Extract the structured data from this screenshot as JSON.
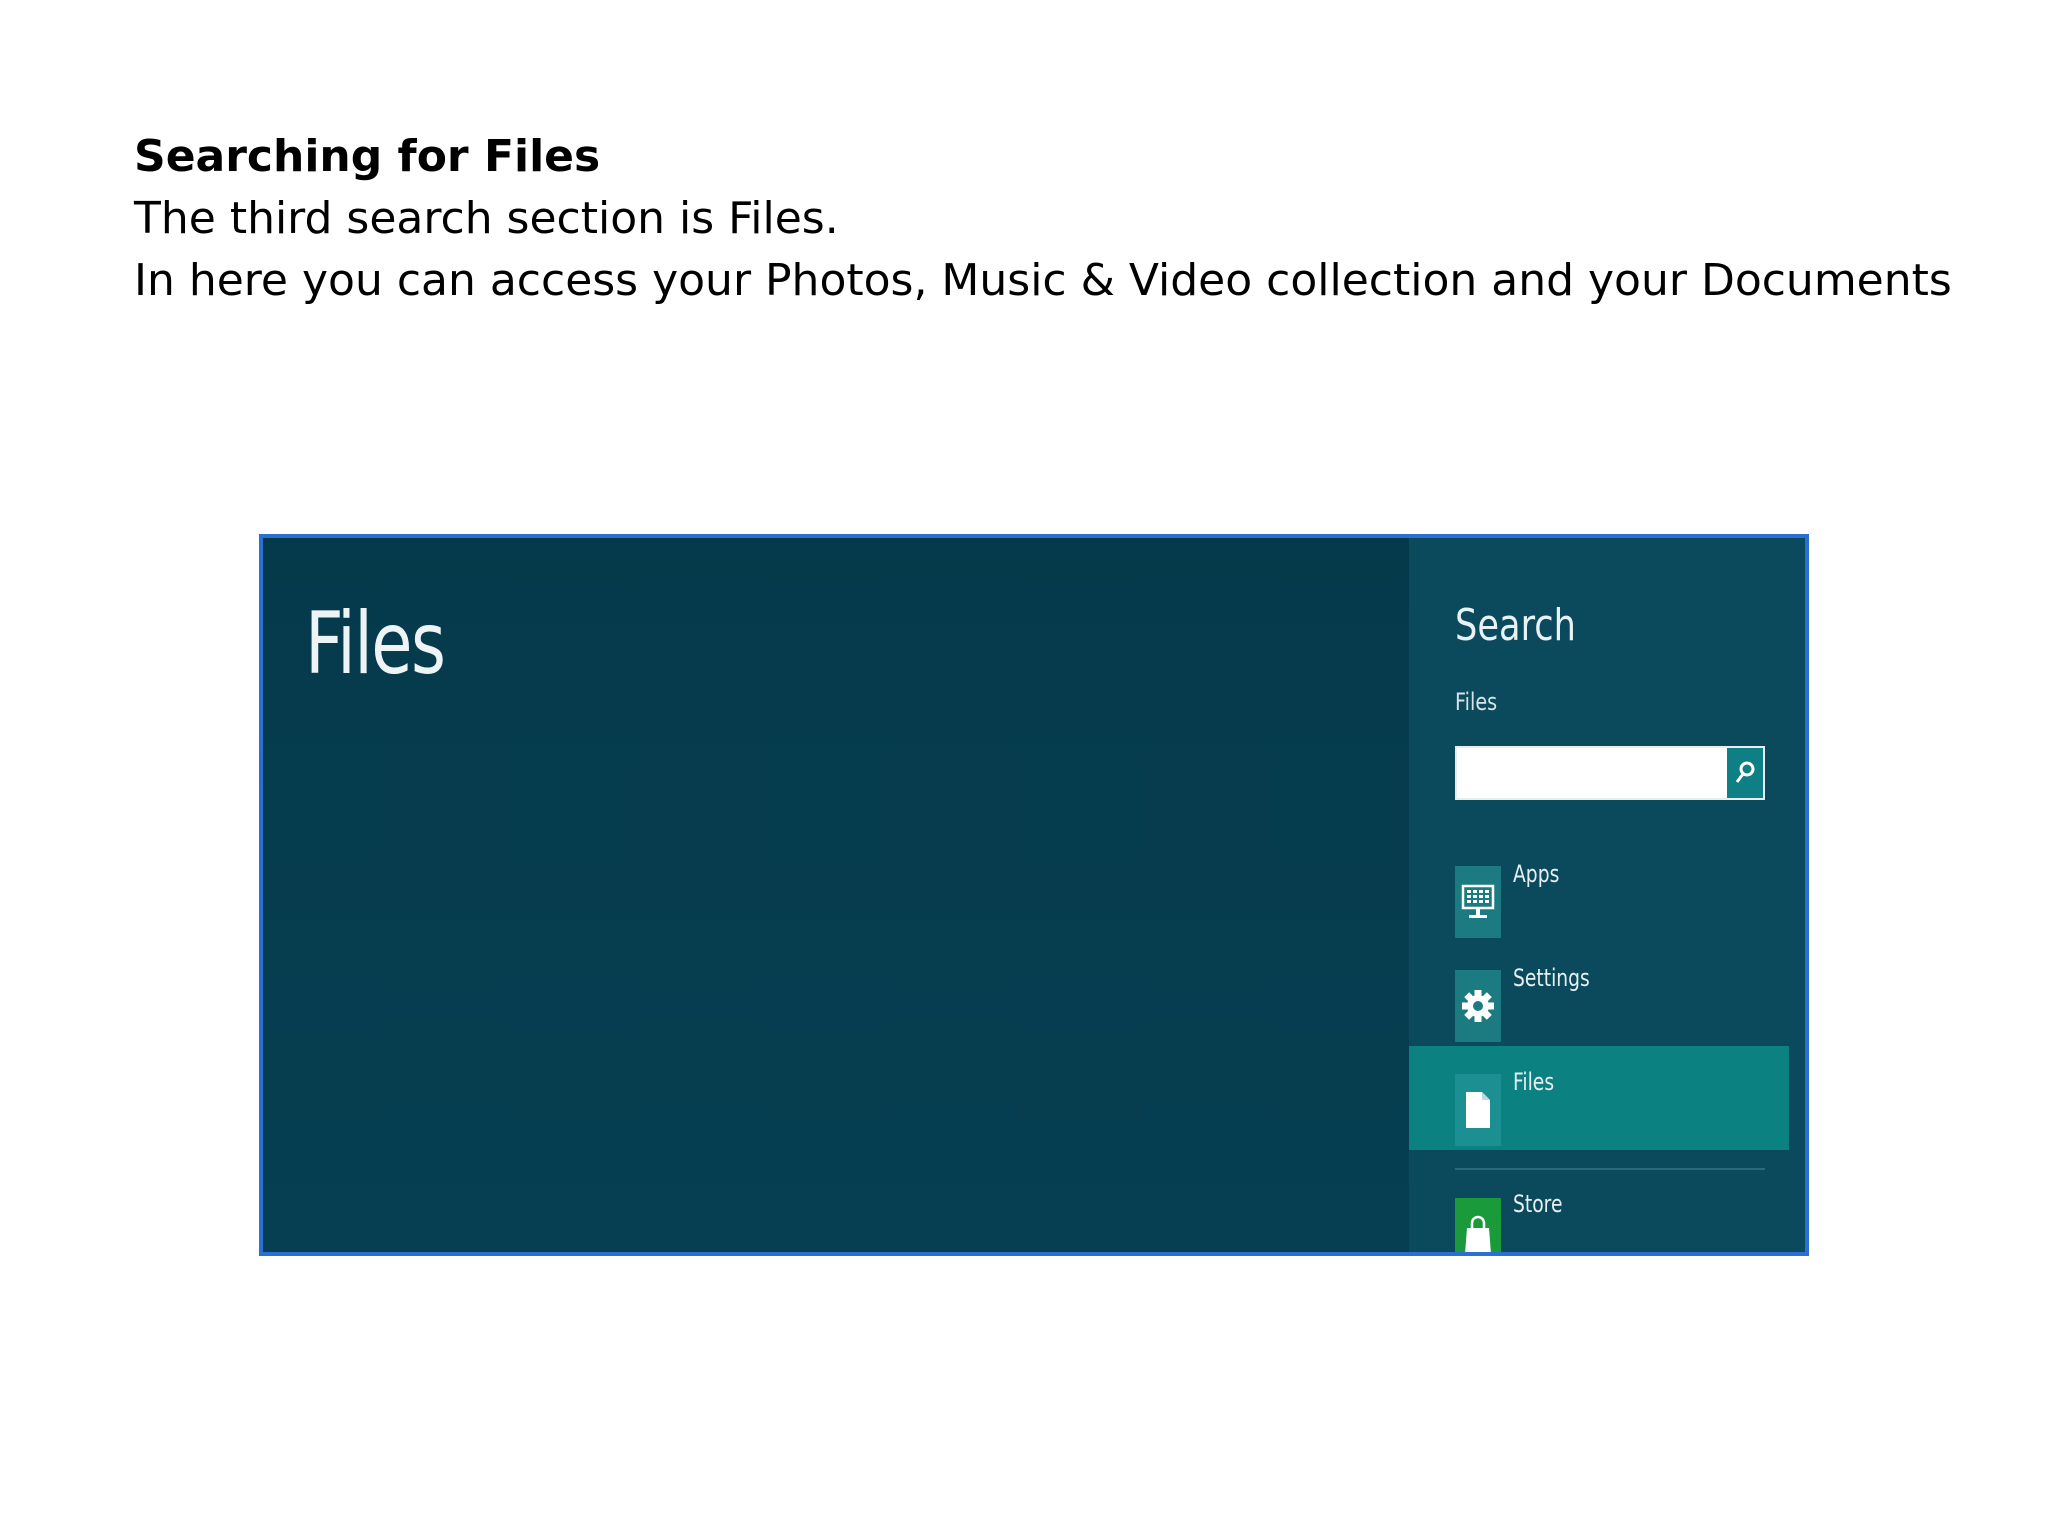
{
  "caption": {
    "heading": "Searching for Files",
    "line1": "The third search section is Files.",
    "line2": "In here you can access your Photos, Music & Video collection and your Documents"
  },
  "screenshot": {
    "main_title": "Files",
    "charm": {
      "title": "Search",
      "scope": "Files",
      "search": {
        "value": "",
        "placeholder": "",
        "button_icon": "search-icon"
      },
      "items": [
        {
          "label": "Apps",
          "icon": "apps-icon",
          "selected": false
        },
        {
          "label": "Settings",
          "icon": "gear-icon",
          "selected": false
        },
        {
          "label": "Files",
          "icon": "file-icon",
          "selected": true
        },
        {
          "label": "Store",
          "icon": "store-bag-icon",
          "selected": false
        }
      ]
    },
    "colors": {
      "frame_border": "#2b6fd3",
      "background": "#053a4b",
      "charm_background": "#0a4a5c",
      "selected": "#0b8181",
      "store_green": "#1a9a3a"
    }
  }
}
